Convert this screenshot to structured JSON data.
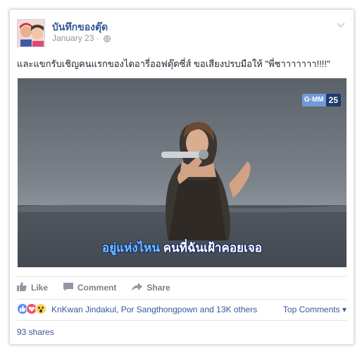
{
  "post": {
    "author": "บันทึกของตุ๊ด",
    "date": "January 23",
    "separator": "·",
    "caption": "และแขกรับเชิญคนแรกของไดอารี่ออฟตุ๊ดซี่ส์ ขอเสียงปรบมือให้ \"พี่ชาาาาาาา!!!!\""
  },
  "video": {
    "channel_prefix": "G·MM",
    "channel_number": "25",
    "subtitle_highlight": "อยู่แห่งไหน",
    "subtitle_rest": "คนที่ฉันเฝ้าคอยเจอ"
  },
  "actions": {
    "like": "Like",
    "comment": "Comment",
    "share": "Share"
  },
  "reactions": {
    "names": "KnKwan Jindakul, Por Sangthongpown and 13K others",
    "top_comments": "Top Comments",
    "sort_arrow": "▾"
  },
  "shares": {
    "count": "93 shares"
  },
  "icons": [
    "avatar",
    "globe-icon",
    "chevron-down-icon",
    "like-icon",
    "comment-icon",
    "share-icon",
    "like-reaction-icon",
    "love-reaction-icon",
    "wow-reaction-icon"
  ],
  "colors": {
    "link": "#365899",
    "muted": "#90949c",
    "action": "#7f7f7f",
    "like_blue": "#5890ff",
    "love_red": "#f25268",
    "wow_yellow": "#fcd462"
  }
}
